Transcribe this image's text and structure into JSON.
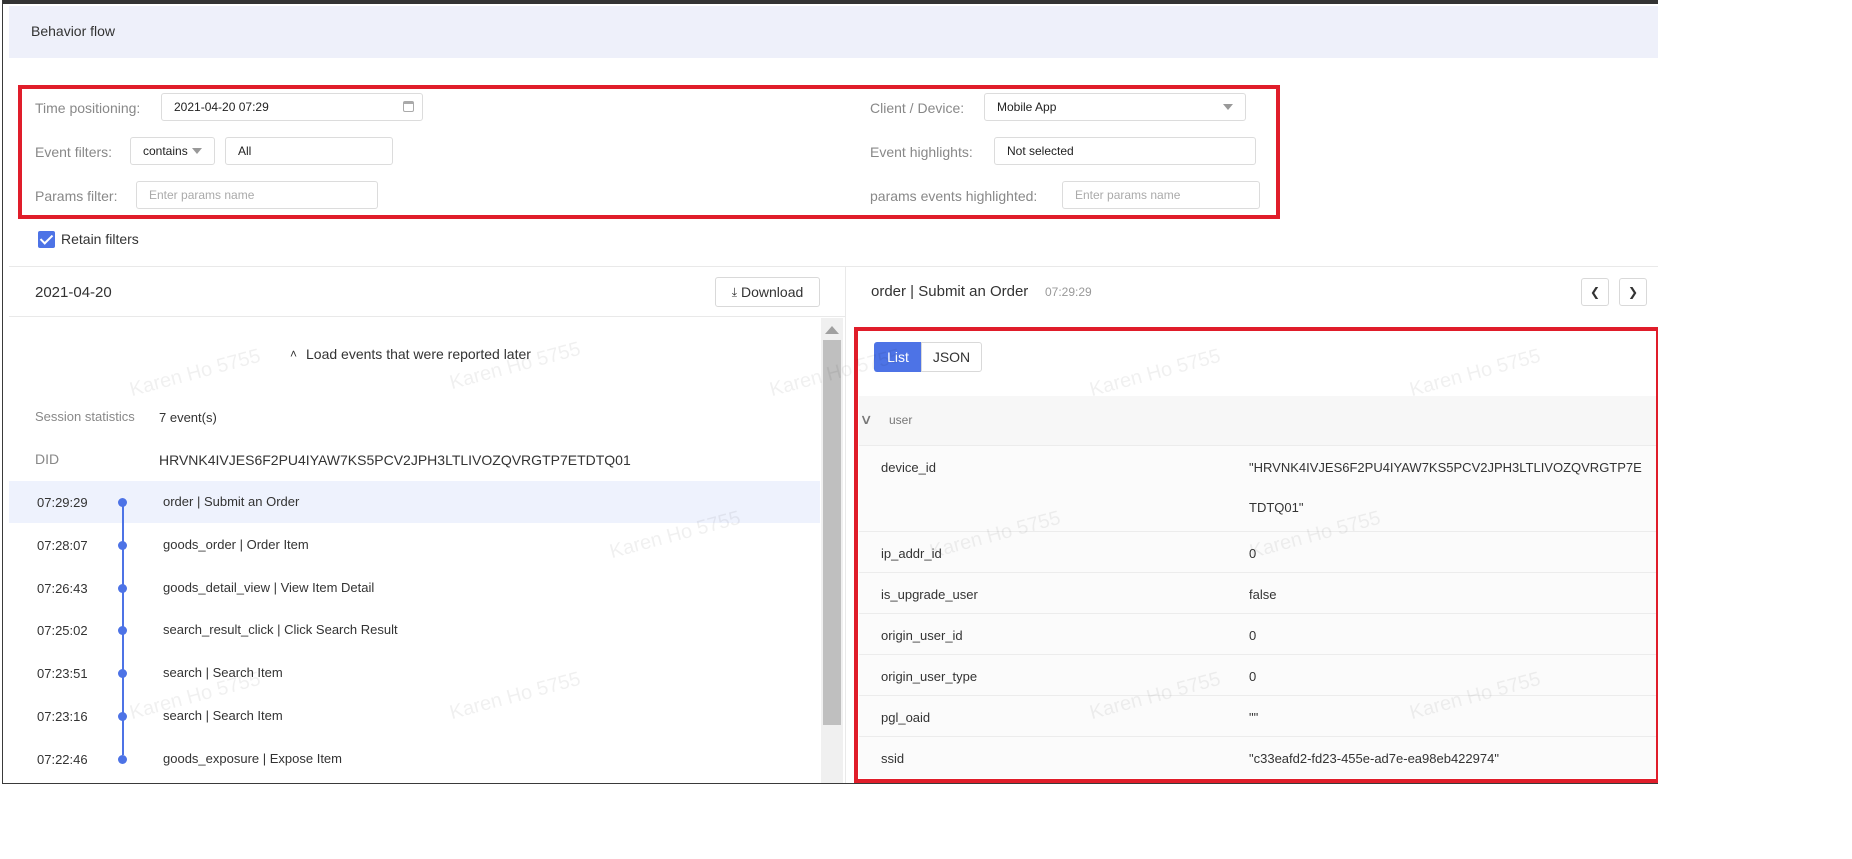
{
  "header": {
    "title": "Behavior flow"
  },
  "filters": {
    "time_positioning_label": "Time positioning:",
    "time_positioning_value": "2021-04-20 07:29",
    "client_device_label": "Client / Device:",
    "client_device_value": "Mobile App",
    "event_filters_label": "Event filters:",
    "event_filters_operator": "contains",
    "event_filters_value": "All",
    "event_highlights_label": "Event highlights:",
    "event_highlights_value": "Not selected",
    "params_filter_label": "Params filter:",
    "params_filter_placeholder": "Enter params name",
    "params_highlight_label": "params events highlighted:",
    "params_highlight_placeholder": "Enter params name",
    "retain_filters_label": "Retain filters"
  },
  "left_panel": {
    "date": "2021-04-20",
    "download_label": "Download",
    "load_later_label": "Load events that were reported later",
    "session_statistics_label": "Session statistics",
    "session_statistics_value": "7 event(s)",
    "did_label": "DID",
    "did_value": "HRVNK4IVJES6F2PU4IYAW7KS5PCV2JPH3LTLIVOZQVRGTP7ETDTQ01",
    "events": [
      {
        "time": "07:29:29",
        "label": "order | Submit an Order"
      },
      {
        "time": "07:28:07",
        "label": "goods_order | Order Item"
      },
      {
        "time": "07:26:43",
        "label": "goods_detail_view | View Item Detail"
      },
      {
        "time": "07:25:02",
        "label": "search_result_click | Click Search Result"
      },
      {
        "time": "07:23:51",
        "label": "search | Search Item"
      },
      {
        "time": "07:23:16",
        "label": "search | Search Item"
      },
      {
        "time": "07:22:46",
        "label": "goods_exposure | Expose Item"
      }
    ]
  },
  "right_panel": {
    "event_title": "order | Submit an Order",
    "event_time": "07:29:29",
    "view_list_label": "List",
    "view_json_label": "JSON",
    "group_label": "user",
    "rows": [
      {
        "key": "device_id",
        "value": "\"HRVNK4IVJES6F2PU4IYAW7KS5PCV2JPH3LTLIVOZQVRGTP7ETDTQ01\""
      },
      {
        "key": "ip_addr_id",
        "value": "0"
      },
      {
        "key": "is_upgrade_user",
        "value": "false"
      },
      {
        "key": "origin_user_id",
        "value": "0"
      },
      {
        "key": "origin_user_type",
        "value": "0"
      },
      {
        "key": "pgl_oaid",
        "value": "\"\""
      },
      {
        "key": "ssid",
        "value": "\"c33eafd2-fd23-455e-ad7e-ea98eb422974\""
      }
    ]
  },
  "watermark_text": "Karen Ho 5755",
  "colors": {
    "accent": "#4d73e6",
    "highlight_box": "#e01d2a",
    "header_bg": "#eef0fa"
  }
}
